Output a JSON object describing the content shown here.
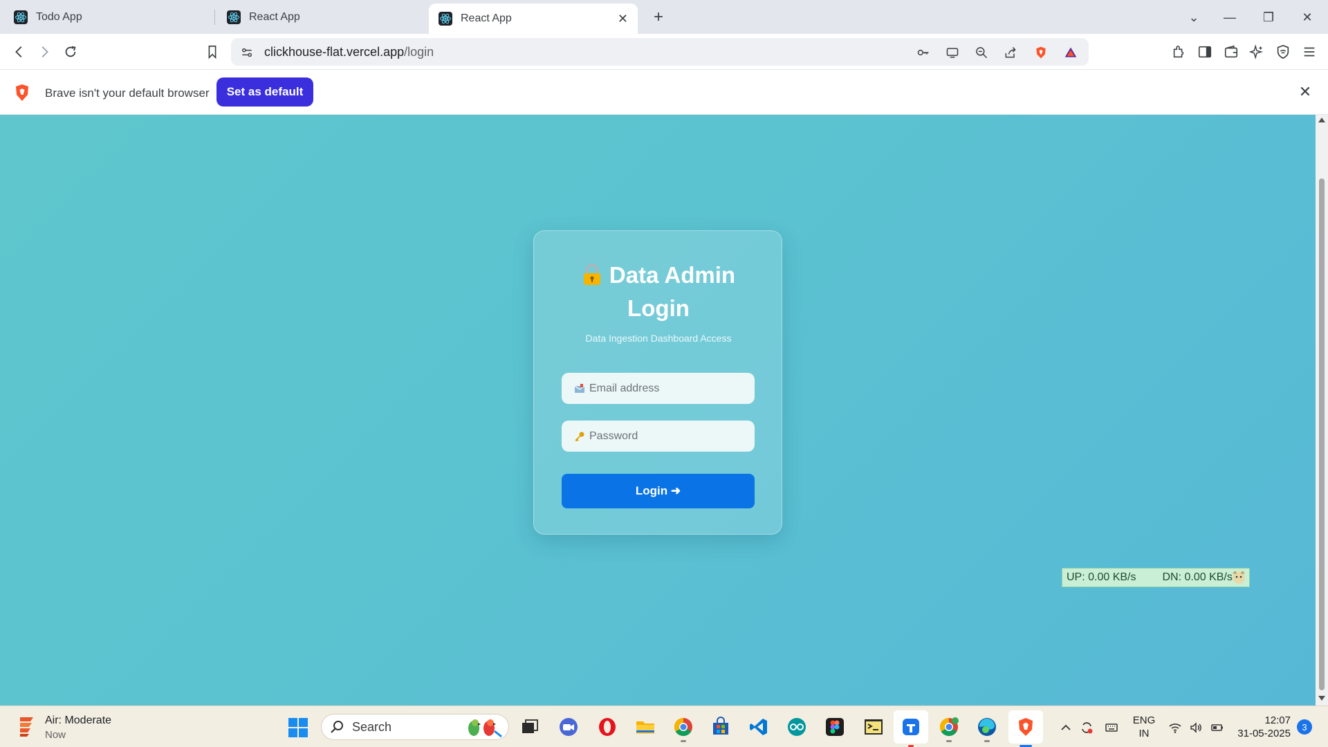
{
  "browser": {
    "tabs": [
      {
        "title": "Todo App",
        "active": false
      },
      {
        "title": "React App",
        "active": false
      },
      {
        "title": "React App",
        "active": true
      }
    ],
    "close_tab_glyph": "✕",
    "new_tab_glyph": "+",
    "url_host": "clickhouse-flat.vercel.app",
    "url_path": "/login",
    "icons": [
      "back-icon",
      "forward-icon",
      "reload-icon",
      "bookmark-icon",
      "site-settings-icon",
      "password-key-icon",
      "cast-icon",
      "zoom-out-icon",
      "share-icon",
      "brave-shields-icon",
      "brave-rewards-icon",
      "extensions-icon",
      "sidebar-icon",
      "wallet-icon",
      "leo-ai-icon",
      "vpn-icon",
      "menu-icon"
    ],
    "window_controls": {
      "tab_search": "⌄",
      "minimize": "—",
      "restore": "❐",
      "close": "✕"
    }
  },
  "infobar": {
    "message": "Brave isn't your default browser",
    "button_label": "Set as default",
    "close_glyph": "✕"
  },
  "login": {
    "title_line1": "Data Admin",
    "title_line2": "Login",
    "subtitle": "Data Ingestion Dashboard Access",
    "email_placeholder": "Email address",
    "password_placeholder": "Password",
    "button_label": "Login ➜"
  },
  "netmon": {
    "up": "UP: 0.00 KB/s",
    "down": "DN: 0.00 KB/s"
  },
  "taskbar": {
    "weather_main": "Air: Moderate",
    "weather_sub": "Now",
    "search_label": "Search",
    "apps": [
      "task-view",
      "zoom",
      "opera",
      "file-explorer",
      "chrome",
      "microsoft-store",
      "vscode",
      "arduino",
      "figma",
      "terminal",
      "todo",
      "chrome-profile",
      "edge",
      "brave"
    ],
    "lang_line1": "ENG",
    "lang_line2": "IN",
    "time": "12:07",
    "date": "31-05-2025",
    "notifications": "3"
  },
  "colors": {
    "accent_blue": "#0a74e6",
    "brave_purple": "#3b2fdd",
    "page_teal": "#5ec6cc"
  }
}
